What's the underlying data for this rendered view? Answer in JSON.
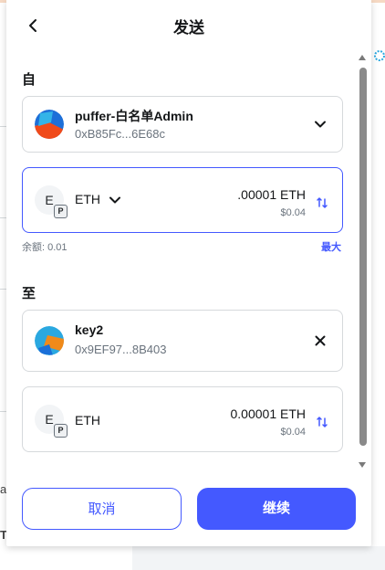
{
  "header": {
    "title": "发送"
  },
  "from": {
    "section_label": "自",
    "account_name": "puffer-白名单Admin",
    "account_address": "0xB85Fc...6E68c"
  },
  "asset": {
    "icon_letter": "E",
    "badge_letter": "P",
    "token": "ETH",
    "amount": ".00001 ETH",
    "fiat": "$0.04",
    "balance_text": "余额: 0.01",
    "max_label": "最大"
  },
  "to": {
    "section_label": "至",
    "account_name": "key2",
    "account_address": "0x9EF97...8B403"
  },
  "receive": {
    "icon_letter": "E",
    "badge_letter": "P",
    "token": "ETH",
    "amount": "0.00001 ETH",
    "fiat": "$0.04"
  },
  "footer": {
    "cancel_label": "取消",
    "continue_label": "继续"
  },
  "background": {
    "left_text_1": "a",
    "left_text_2": "T"
  },
  "colors": {
    "accent": "#4459ff",
    "border": "#d6d9dc",
    "muted": "#6a737d"
  },
  "icons": {
    "back": "arrow-left-icon",
    "dropdown": "chevron-down-icon",
    "swap": "swap-vertical-icon",
    "close": "close-icon"
  }
}
